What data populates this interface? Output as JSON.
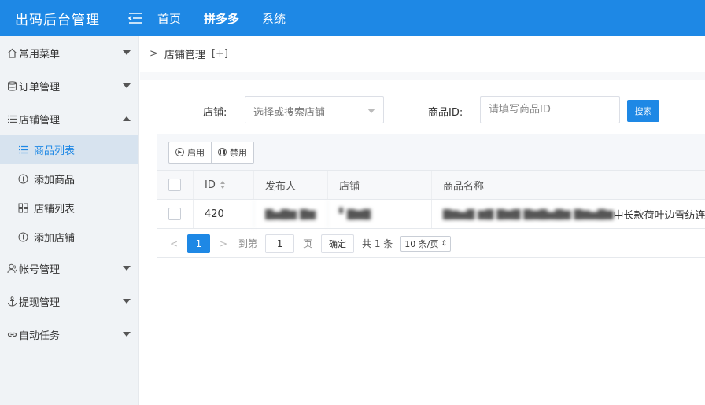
{
  "app": {
    "title": "出码后台管理"
  },
  "topnav": {
    "items": [
      "首页",
      "拼多多",
      "系统"
    ]
  },
  "sidebar": {
    "groups": [
      {
        "label": "常用菜单",
        "icon": "home-icon"
      },
      {
        "label": "订单管理",
        "icon": "database-icon"
      },
      {
        "label": "店铺管理",
        "icon": "list-icon"
      },
      {
        "label": "帐号管理",
        "icon": "user-icon"
      },
      {
        "label": "提现管理",
        "icon": "anchor-icon"
      },
      {
        "label": "自动任务",
        "icon": "link-icon"
      }
    ],
    "subitems": [
      {
        "label": "商品列表",
        "icon": "list-icon"
      },
      {
        "label": "添加商品",
        "icon": "plus-circle-icon"
      },
      {
        "label": "店铺列表",
        "icon": "grid-icon"
      },
      {
        "label": "添加店铺",
        "icon": "plus-circle-icon"
      }
    ]
  },
  "breadcrumb": {
    "arrow": ">",
    "text": "店铺管理",
    "extra": "[+]"
  },
  "filter": {
    "shop_label": "店铺:",
    "shop_placeholder": "选择或搜索店铺",
    "goods_label": "商品ID:",
    "goods_placeholder": "请填写商品ID",
    "search_label": "搜索"
  },
  "toolbar": {
    "enable_label": "启用",
    "disable_label": "禁用"
  },
  "table": {
    "columns": [
      "ID",
      "发布人",
      "店铺",
      "商品名称"
    ],
    "rows": [
      {
        "id": "420",
        "publisher": "▇▅▇▆ ▇▆",
        "shop": "▘▇▆▇",
        "name_blurred": "▇▆▅▇ ▆▇ ▇▆▇ ▇▆▇▅▇▆ ▇▆▅▇▆",
        "name_visible": "中长款荷叶边雪纺连衣"
      }
    ]
  },
  "pagination": {
    "current": "1",
    "goto_label": "到第",
    "goto_value": "1",
    "page_unit": "页",
    "confirm_label": "确定",
    "total": "共 1 条",
    "page_size": "10 条/页"
  },
  "colors": {
    "primary": "#1e88e5",
    "sidebar_bg": "#f0f3f6",
    "active_item_bg": "#d7e3ef"
  }
}
